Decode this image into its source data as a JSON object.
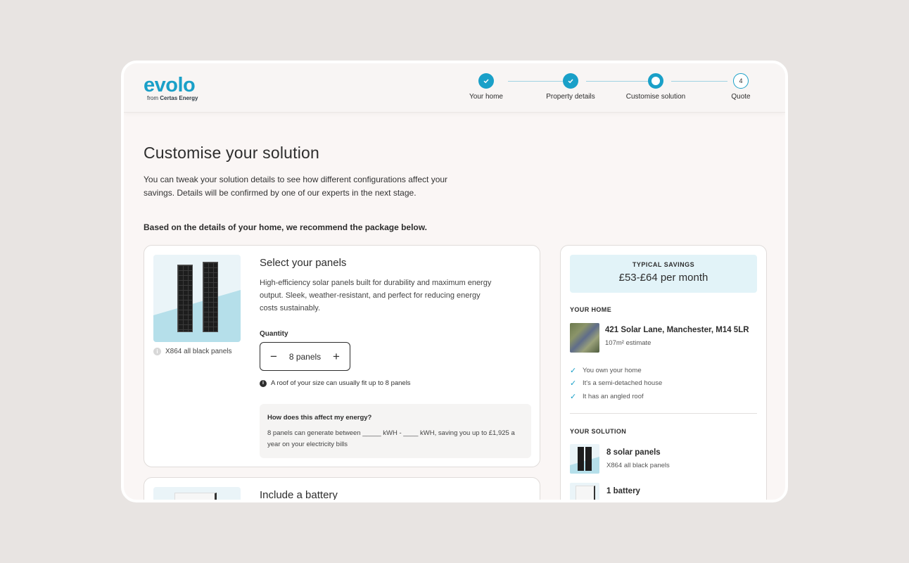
{
  "brand": {
    "name": "evolo",
    "sub_prefix": "from",
    "sub_company": "Certas Energy",
    "color": "#1aa0c8"
  },
  "steps": [
    {
      "label": "Your home",
      "state": "done"
    },
    {
      "label": "Property details",
      "state": "done"
    },
    {
      "label": "Customise solution",
      "state": "current"
    },
    {
      "label": "Quote",
      "state": "todo",
      "number": "4"
    }
  ],
  "page": {
    "title": "Customise your solution",
    "intro": "You can tweak your solution details to see how different configurations affect your savings. Details will be confirmed by one of our experts in the next stage.",
    "recommendation": "Based on the details of your home, we recommend the package below."
  },
  "panels": {
    "title": "Select your panels",
    "description": "High-efficiency solar panels built for durability and maximum energy output. Sleek, weather-resistant, and perfect for reducing energy costs sustainably.",
    "caption": "X864 all black panels",
    "quantity_label": "Quantity",
    "quantity_value": "8 panels",
    "hint": "A roof of your size can usually fit up to 8 panels",
    "energy_question": "How does this affect my energy?",
    "energy_answer": "8 panels can generate between _____ kWH - ____ kWH, saving you up to £1,925 a year on your electricity bills"
  },
  "battery": {
    "title": "Include a battery"
  },
  "summary": {
    "savings_label": "TYPICAL SAVINGS",
    "savings_amount": "£53-£64 per month",
    "home_title": "YOUR HOME",
    "address": "421 Solar Lane, Manchester, M14 5LR",
    "size": "107m² estimate",
    "checks": [
      "You own your home",
      "It's a semi-detached house",
      "It has an angled roof"
    ],
    "solution_title": "YOUR SOLUTION",
    "items": [
      {
        "name": "8 solar panels",
        "sub": "X864 all black panels"
      },
      {
        "name": "1 battery",
        "sub": ""
      }
    ]
  }
}
